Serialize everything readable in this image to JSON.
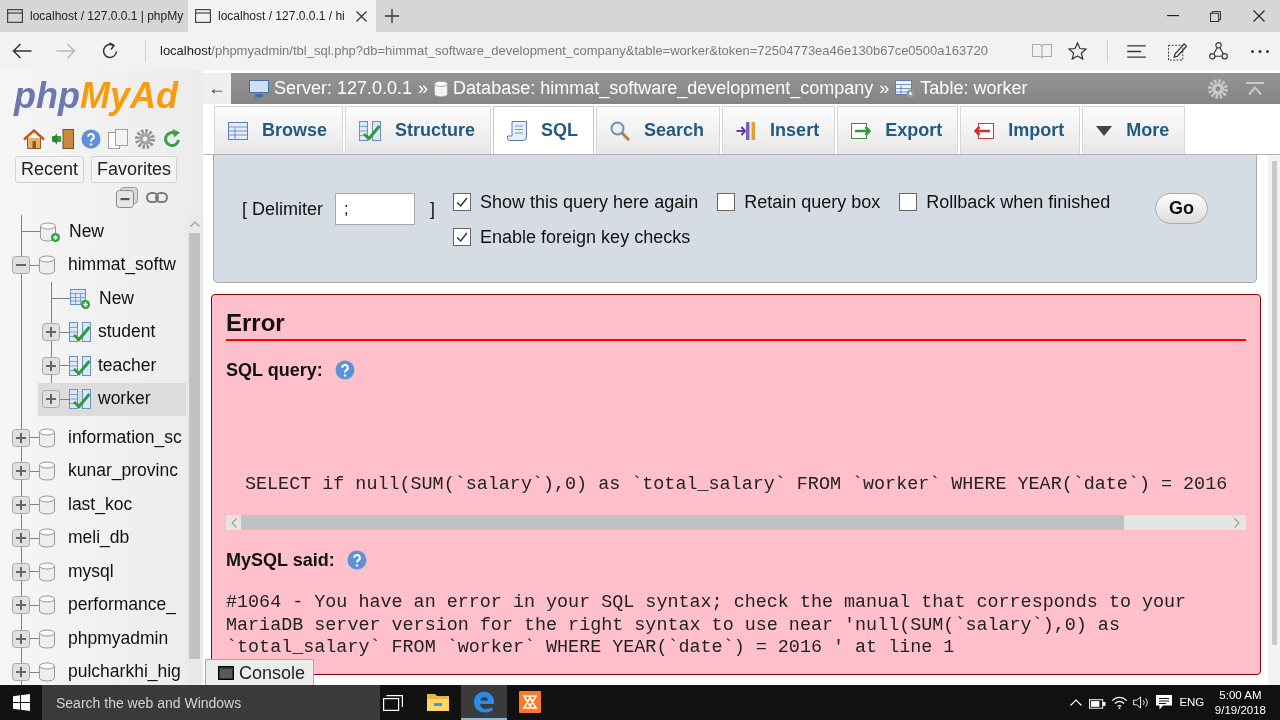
{
  "browser": {
    "tabs": [
      {
        "title": "localhost / 127.0.0.1 | phpMy",
        "selected": false
      },
      {
        "title": "localhost / 127.0.0.1 / hi",
        "selected": true
      }
    ],
    "nav_buttons": [
      {
        "kind": "back",
        "disabled": false
      },
      {
        "kind": "forward",
        "disabled": true
      },
      {
        "kind": "refresh",
        "disabled": false
      }
    ],
    "address": {
      "host": "localhost",
      "path": "/phpmyadmin/tbl_sql.php?db=himmat_software_development_company&table=worker&token=72504773ea46e130b67ce0500a163720"
    }
  },
  "sidebar": {
    "logo": [
      {
        "text": "php"
      },
      {
        "text": "MyAd"
      }
    ],
    "quick_tabs": [
      "Recent",
      "Favorites"
    ],
    "tree": [
      {
        "label": "New",
        "kind": "new",
        "selected": false
      },
      {
        "label": "himmat_softw",
        "kind": "database",
        "expanded": true,
        "selected": false,
        "children": [
          {
            "label": "New",
            "kind": "new-table",
            "selected": false
          },
          {
            "label": "student",
            "kind": "table",
            "expanded": false,
            "selected": false
          },
          {
            "label": "teacher",
            "kind": "table",
            "expanded": false,
            "selected": false
          },
          {
            "label": "worker",
            "kind": "table",
            "expanded": false,
            "selected": true
          }
        ]
      },
      {
        "label": "information_sc",
        "kind": "database",
        "expanded": false,
        "selected": false
      },
      {
        "label": "kunar_provinc",
        "kind": "database",
        "expanded": false,
        "selected": false
      },
      {
        "label": "last_koc",
        "kind": "database",
        "expanded": false,
        "selected": false
      },
      {
        "label": "meli_db",
        "kind": "database",
        "expanded": false,
        "selected": false
      },
      {
        "label": "mysql",
        "kind": "database",
        "expanded": false,
        "selected": false
      },
      {
        "label": "performance_",
        "kind": "database",
        "expanded": false,
        "selected": false
      },
      {
        "label": "phpmyadmin",
        "kind": "database",
        "expanded": false,
        "selected": false
      },
      {
        "label": "pulcharkhi_hig",
        "kind": "database",
        "expanded": false,
        "selected": false
      }
    ]
  },
  "main": {
    "back_button": "←",
    "breadcrumb": [
      {
        "kind": "server",
        "text": "Server: 127.0.0.1"
      },
      {
        "kind": "separator",
        "text": "»"
      },
      {
        "kind": "database",
        "text": "Database: himmat_software_development_company"
      },
      {
        "kind": "separator",
        "text": "»"
      },
      {
        "kind": "table",
        "text": "Table: worker"
      }
    ],
    "tabs": [
      {
        "label": "Browse",
        "kind": "browse",
        "selected": false
      },
      {
        "label": "Structure",
        "kind": "structure",
        "selected": false
      },
      {
        "label": "SQL",
        "kind": "sql",
        "selected": true
      },
      {
        "label": "Search",
        "kind": "search",
        "selected": false
      },
      {
        "label": "Insert",
        "kind": "insert",
        "selected": false
      },
      {
        "label": "Export",
        "kind": "export",
        "selected": false
      },
      {
        "label": "Import",
        "kind": "import",
        "selected": false
      },
      {
        "label": "More",
        "kind": "more",
        "selected": false
      }
    ],
    "query_options": {
      "delimiter_label": "[ Delimiter",
      "delimiter_value": ";",
      "delimiter_close": "]",
      "options": [
        {
          "label": "Show this query here again",
          "checked": true
        },
        {
          "label": "Retain query box",
          "checked": false
        },
        {
          "label": "Rollback when finished",
          "checked": false
        },
        {
          "label": "Enable foreign key checks",
          "checked": true
        }
      ],
      "go_button": "Go"
    },
    "error": {
      "title": "Error",
      "query_label": "SQL query:",
      "query": "SELECT if null(SUM(`salary`),0) as `total_salary` FROM `worker` WHERE YEAR(`date`) = 2016",
      "said_label": "MySQL said:",
      "message": "#1064 - You have an error in your SQL syntax; check the manual that corresponds to your MariaDB server version for the right syntax to use near 'null(SUM(`salary`),0) as `total_salary` FROM `worker` WHERE YEAR(`date`) = 2016 ' at line 1"
    },
    "console_button": "Console"
  },
  "taskbar": {
    "search_placeholder": "Search the web and Windows",
    "apps": [
      {
        "kind": "folder",
        "active": false
      },
      {
        "kind": "browser",
        "active": true
      },
      {
        "kind": "server-panel",
        "active": false
      }
    ],
    "language": "ENG",
    "time": "5:00 AM",
    "date": "9/19/2018"
  }
}
